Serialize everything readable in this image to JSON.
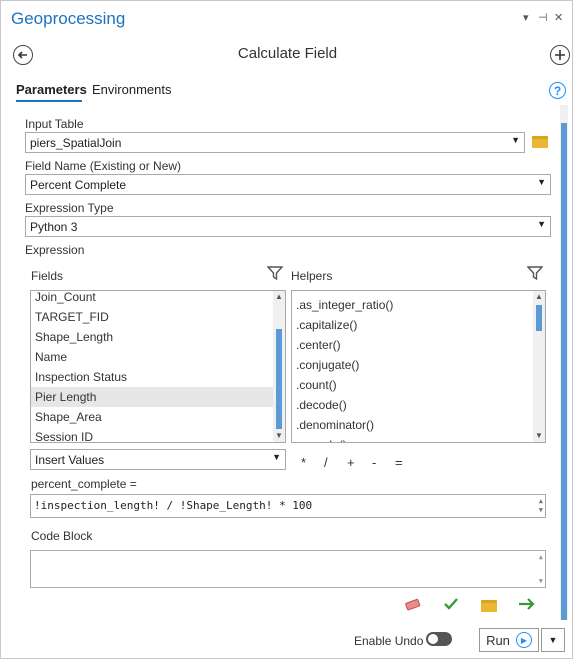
{
  "pane": {
    "title": "Geoprocessing",
    "controls": [
      "▾",
      "⊣",
      "✕"
    ]
  },
  "header": {
    "back_icon": "back-arrow-icon",
    "tool_title": "Calculate Field",
    "add_icon": "add-circle-icon"
  },
  "tabs": [
    {
      "label": "Parameters",
      "active": true
    },
    {
      "label": "Environments",
      "active": false
    }
  ],
  "params": {
    "input_table_label": "Input Table",
    "input_table_value": "piers_SpatialJoin",
    "field_name_label": "Field Name (Existing or New)",
    "field_name_value": "Percent Complete",
    "expression_type_label": "Expression Type",
    "expression_type_value": "Python 3",
    "expression_label": "Expression"
  },
  "fields": {
    "label": "Fields",
    "items": [
      "Join_Count",
      "TARGET_FID",
      "Shape_Length",
      "Name",
      "Inspection Status",
      "Pier Length",
      "Shape_Area",
      "Session ID"
    ],
    "selected": "Pier Length"
  },
  "helpers": {
    "label": "Helpers",
    "items": [
      ".as_integer_ratio()",
      ".capitalize()",
      ".center()",
      ".conjugate()",
      ".count()",
      ".decode()",
      ".denominator()",
      ".encode()"
    ]
  },
  "insert": {
    "dropdown_value": "Insert Values",
    "operators": [
      "*",
      "/",
      "+",
      "-",
      "="
    ]
  },
  "expression": {
    "target": "percent_complete =",
    "code": "!inspection_length! / !Shape_Length! * 100"
  },
  "code_block": {
    "label": "Code Block",
    "value": ""
  },
  "footer": {
    "enable_undo_label": "Enable Undo",
    "run_label": "Run"
  },
  "colors": {
    "accent": "#1e73be",
    "scroll_thumb": "#5b9bd5",
    "check": "#3a9a3a",
    "folder": "#e8b834"
  }
}
